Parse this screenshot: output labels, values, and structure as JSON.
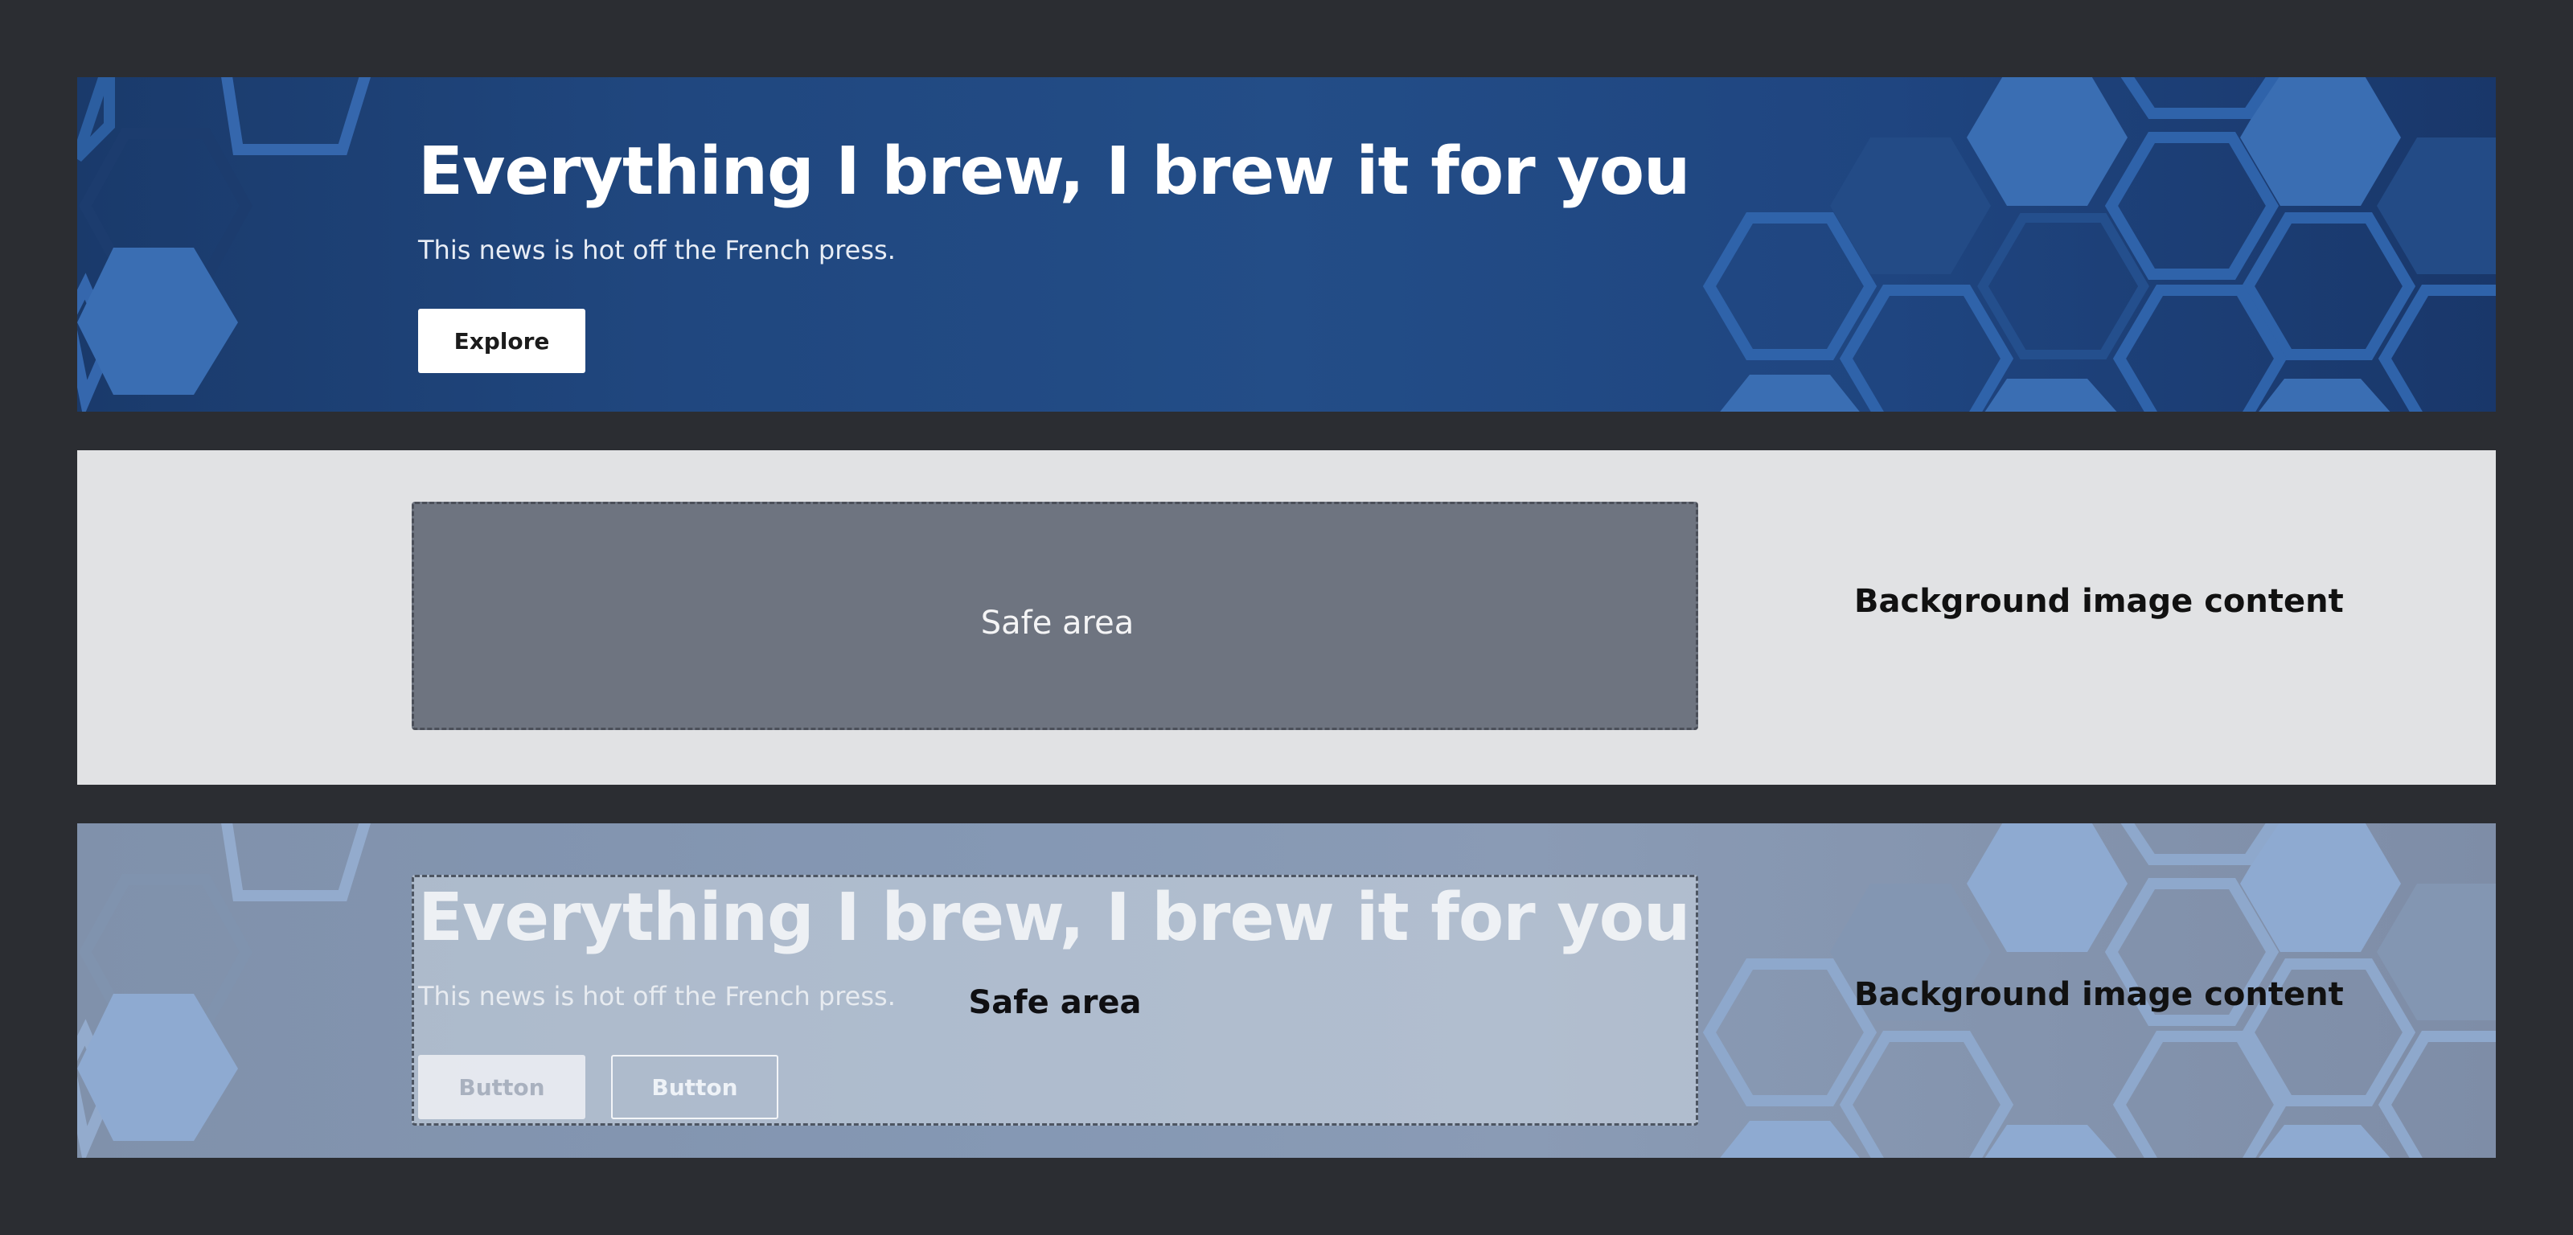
{
  "banner": {
    "headline": "Everything I brew, I brew it for you",
    "subtext": "This news is hot off the French press.",
    "button_label": "Explore"
  },
  "safe_area_diagram": {
    "safe_area_label": "Safe area",
    "background_label": "Background image content"
  },
  "overlay_example": {
    "headline": "Everything I brew, I brew it for you",
    "subtext": "This news is hot off the French press.",
    "primary_button_label": "Button",
    "secondary_button_label": "Button",
    "safe_area_label": "Safe area",
    "background_label": "Background image content"
  },
  "icons": [
    "hexagon-pattern-left",
    "hexagon-pattern-right"
  ],
  "colors": {
    "page_background": "#2b2d32",
    "banner_blue": "#20477f",
    "hex_light": "#3a72b8",
    "safe_area_fill": "#6e7480",
    "diagram_background": "#e1e2e4"
  }
}
